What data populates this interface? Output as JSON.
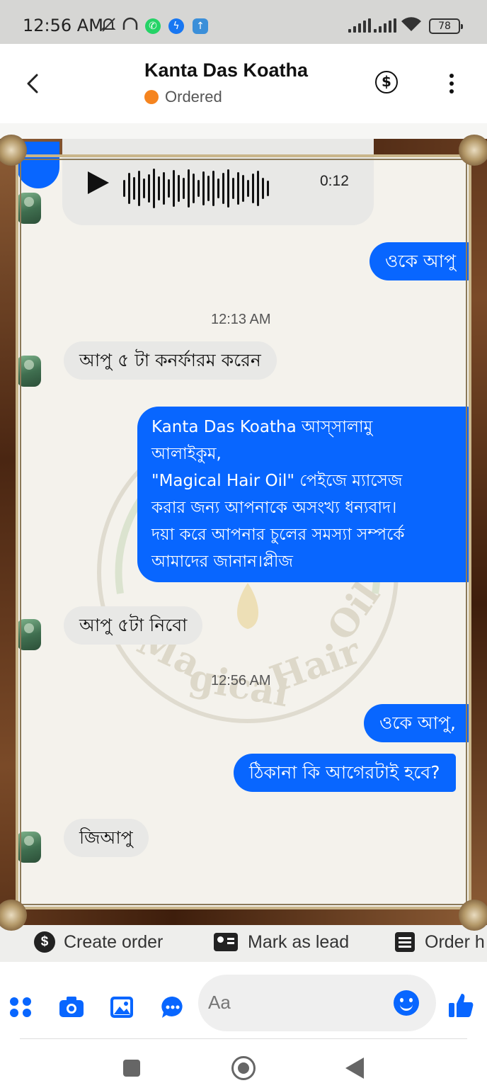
{
  "status_bar": {
    "time": "12:56 AM",
    "battery": "78"
  },
  "header": {
    "contact_name": "Kanta Das Koatha",
    "status_label": "Ordered",
    "status_color": "#f5841f"
  },
  "colors": {
    "outgoing_bubble": "#0866ff",
    "incoming_bubble": "#e8e8e6"
  },
  "watermark": {
    "brand_text": "Magical Hair Oil"
  },
  "messages": [
    {
      "type": "audio",
      "duration": "0:12"
    },
    {
      "type": "text",
      "direction": "out",
      "text": "ওকে আপু"
    },
    {
      "type": "timestamp",
      "text": "12:13 AM"
    },
    {
      "type": "text",
      "direction": "in",
      "text": "আপু ৫ টা কনর্ফারম করেন"
    },
    {
      "type": "text",
      "direction": "out",
      "lines": [
        "Kanta Das Koatha আস্সালামু",
        "আলাইকুম,",
        "\"Magical Hair Oil\" পেইজে ম্যাসেজ",
        "করার জন্য আপনাকে অসংখ্য ধন্যবাদ।",
        "দয়া করে আপনার চুলের সমস্যা সম্পর্কে",
        "আমাদের জানান।প্লীজ"
      ]
    },
    {
      "type": "text",
      "direction": "in",
      "text": "আপু ৫টা নিবো"
    },
    {
      "type": "timestamp",
      "text": "12:56 AM"
    },
    {
      "type": "text",
      "direction": "out",
      "text": "ওকে আপু,"
    },
    {
      "type": "text",
      "direction": "out",
      "text": "ঠিকানা কি আগেরটাই হবে?"
    },
    {
      "type": "text",
      "direction": "in",
      "text": "জিআপু"
    }
  ],
  "quick_actions": [
    {
      "label": "Create order",
      "icon": "dollar-icon"
    },
    {
      "label": "Mark as lead",
      "icon": "contact-card-icon"
    },
    {
      "label": "Order h",
      "icon": "list-icon"
    }
  ],
  "composer": {
    "placeholder": "Aa"
  }
}
